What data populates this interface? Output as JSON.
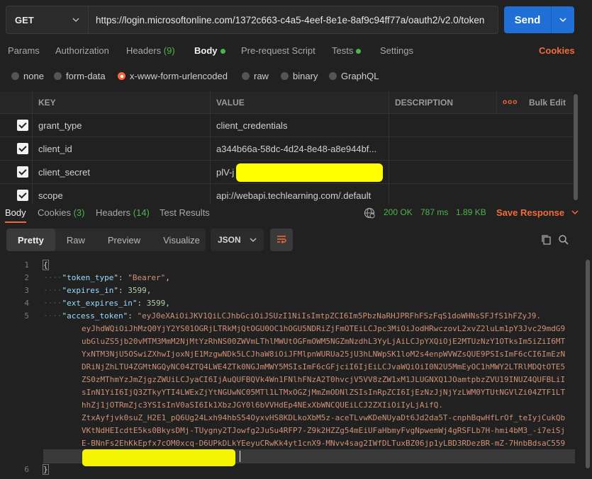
{
  "request": {
    "method": "GET",
    "url": "https://login.microsoftonline.com/1372c663-c4a5-4eef-8e1e-8af9c94ff77a/oauth2/v2.0/token",
    "send_label": "Send"
  },
  "request_tabs": {
    "params": "Params",
    "authorization": "Authorization",
    "headers": "Headers",
    "headers_count": "(9)",
    "body": "Body",
    "prerequest": "Pre-request Script",
    "tests": "Tests",
    "settings": "Settings",
    "cookies": "Cookies"
  },
  "body_types": {
    "none": "none",
    "form_data": "form-data",
    "urlencoded": "x-www-form-urlencoded",
    "raw": "raw",
    "binary": "binary",
    "graphql": "GraphQL",
    "selected": "x-www-form-urlencoded"
  },
  "params_table": {
    "headers": {
      "key": "KEY",
      "value": "VALUE",
      "description": "DESCRIPTION",
      "more": "ooo",
      "bulk_edit": "Bulk Edit"
    },
    "rows": [
      {
        "key": "grant_type",
        "value": "client_credentials"
      },
      {
        "key": "client_id",
        "value": "a344b66a-58dc-4d24-8e48-a8e944bf..."
      },
      {
        "key": "client_secret",
        "value": "plV-j"
      },
      {
        "key": "scope",
        "value": "api://webapi.techlearning.com/.default"
      }
    ]
  },
  "response_tabs": {
    "body": "Body",
    "cookies": "Cookies",
    "cookies_count": "(3)",
    "headers": "Headers",
    "headers_count": "(14)",
    "test_results": "Test Results",
    "status": "200 OK",
    "time": "787 ms",
    "size": "1.89 KB",
    "save_response": "Save Response"
  },
  "response_toolbar": {
    "pretty": "Pretty",
    "raw": "Raw",
    "preview": "Preview",
    "visualize": "Visualize",
    "format": "JSON"
  },
  "response_body": {
    "line_numbers": [
      "1",
      "2",
      "3",
      "4",
      "5",
      "6"
    ],
    "open_brace": "{",
    "close_brace": "}",
    "token_type_key": "\"token_type\"",
    "token_type_value": "\"Bearer\"",
    "expires_in_key": "\"expires_in\"",
    "expires_in_value": "3599",
    "ext_expires_in_key": "\"ext_expires_in\"",
    "ext_expires_in_value": "3599",
    "access_token_key": "\"access_token\"",
    "access_token_lines": [
      "\"eyJ0eXAiOiJKV1QiLCJhbGciOiJSUzI1NiIsImtpZCI6Im5PbzNaRHJPRFhFSzFqS1doWHNsSFJfS1hFZyJ9.",
      "eyJhdWQiOiJhMzQ0YjY2YS01OGRjLTRkMjQtOGU0OC1hOGU5NDRiZjFmOTEiLCJpc3MiOiJodHRwczovL2xvZ2luLm1pY3Jvc29mdG9",
      "ubGluZS5jb20vMTM3MmM2NjMtYzRhNS00ZWVmLThlMWUtOGFmOWM5NGZmNzdhL3YyLjAiLCJpYXQiOjE2MTUzNzY1OTksIm5iZiI6MT",
      "YxNTM3NjU5OSwiZXhwIjoxNjE1MzgwNDk5LCJhaW8iOiJFMlpnWURUa25jU3hLNWpSK1loM2s4enpWVWZsQUE9PSIsImF6cCI6ImEzN",
      "DRiNjZhLTU4ZGMtNGQyNC04ZTQ4LWE4ZTk0NGJmMWY5MSIsImF6cGFjciI6IjEiLCJvaWQiOiI0N2U5MmEyOC1hMWY2LTRlMDQtOTE5",
      "ZS0zMThmYzJmZjgzZWUiLCJyaCI6IjAuQUFBQVk4Wn1FNlhFNzA2T0hvcjV5VV8zZW1xM1JLUGNXQ1JOamtpbzZVU19INUZ4QUFBLiI",
      "sInN1YiI6IjQ3ZTkyYTI4LWExZjYtNGUwNC05MTl1LTMxOGZjMmZmODNlZSIsInRpZCI6IjEzNzJjNjYzLWM0YTUtNGVlZi04ZTF1LT",
      "hhZj1jOTRmZjc3YSIsInV0aSI6Ik1XbzJGY0l6bVVHdEp4NExXbWNCQUEiLCJ2ZXIiOiIyLjAifQ.",
      "ZtxAyfjvk0suZ_H2E1_pQ6Ug24Lxh94hbS54OyxvHS8KDLkoXbM5z-aceTLvwKDeNUyaDt6Jd2da5T-cnphBqwHfLrOf_teIyjCukQb",
      "VKtNdHEIcdtE5ks0BkysDMj-TUygny2TJowfg2JuSu4RFP7-Z9k2HZZg54mEiUFaHbmyFvgNpwemWj4gRSFLb7H-hmi4bM3_-i7eiSj",
      "E-BNnFs2EhKkEpfx7cOM0xcq-D6UPkDLkYEeyuCRwKk4yt1cnX9-MNvv4sag2IWfDLTuxBZ06jp1yLBD3RDezBR-mZ-7HnbBdsaC559"
    ]
  }
}
